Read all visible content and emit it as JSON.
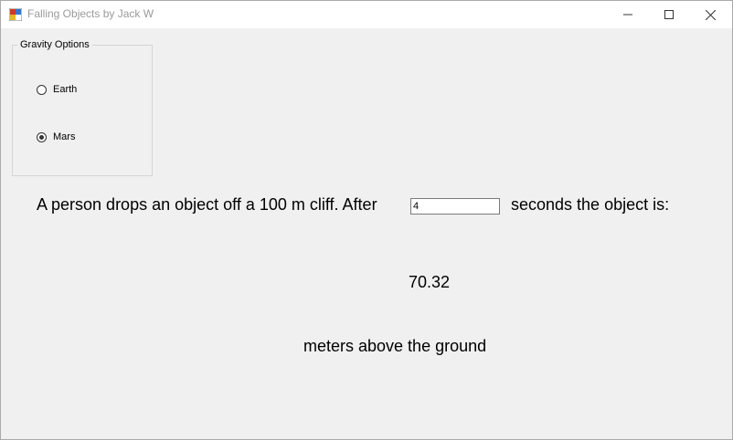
{
  "window": {
    "title": "Falling Objects by Jack W"
  },
  "gravity_group": {
    "legend": "Gravity Options",
    "options": [
      {
        "label": "Earth",
        "selected": false
      },
      {
        "label": "Mars",
        "selected": true
      }
    ]
  },
  "question": {
    "prefix": "A person drops an object off a 100 m cliff. After",
    "seconds_value": "4",
    "suffix": "seconds the object is:"
  },
  "result": {
    "value": "70.32",
    "unit_text": "meters above the ground"
  },
  "icons": {
    "app": "app-icon",
    "minimize": "minimize-icon",
    "maximize": "maximize-icon",
    "close": "close-icon"
  }
}
